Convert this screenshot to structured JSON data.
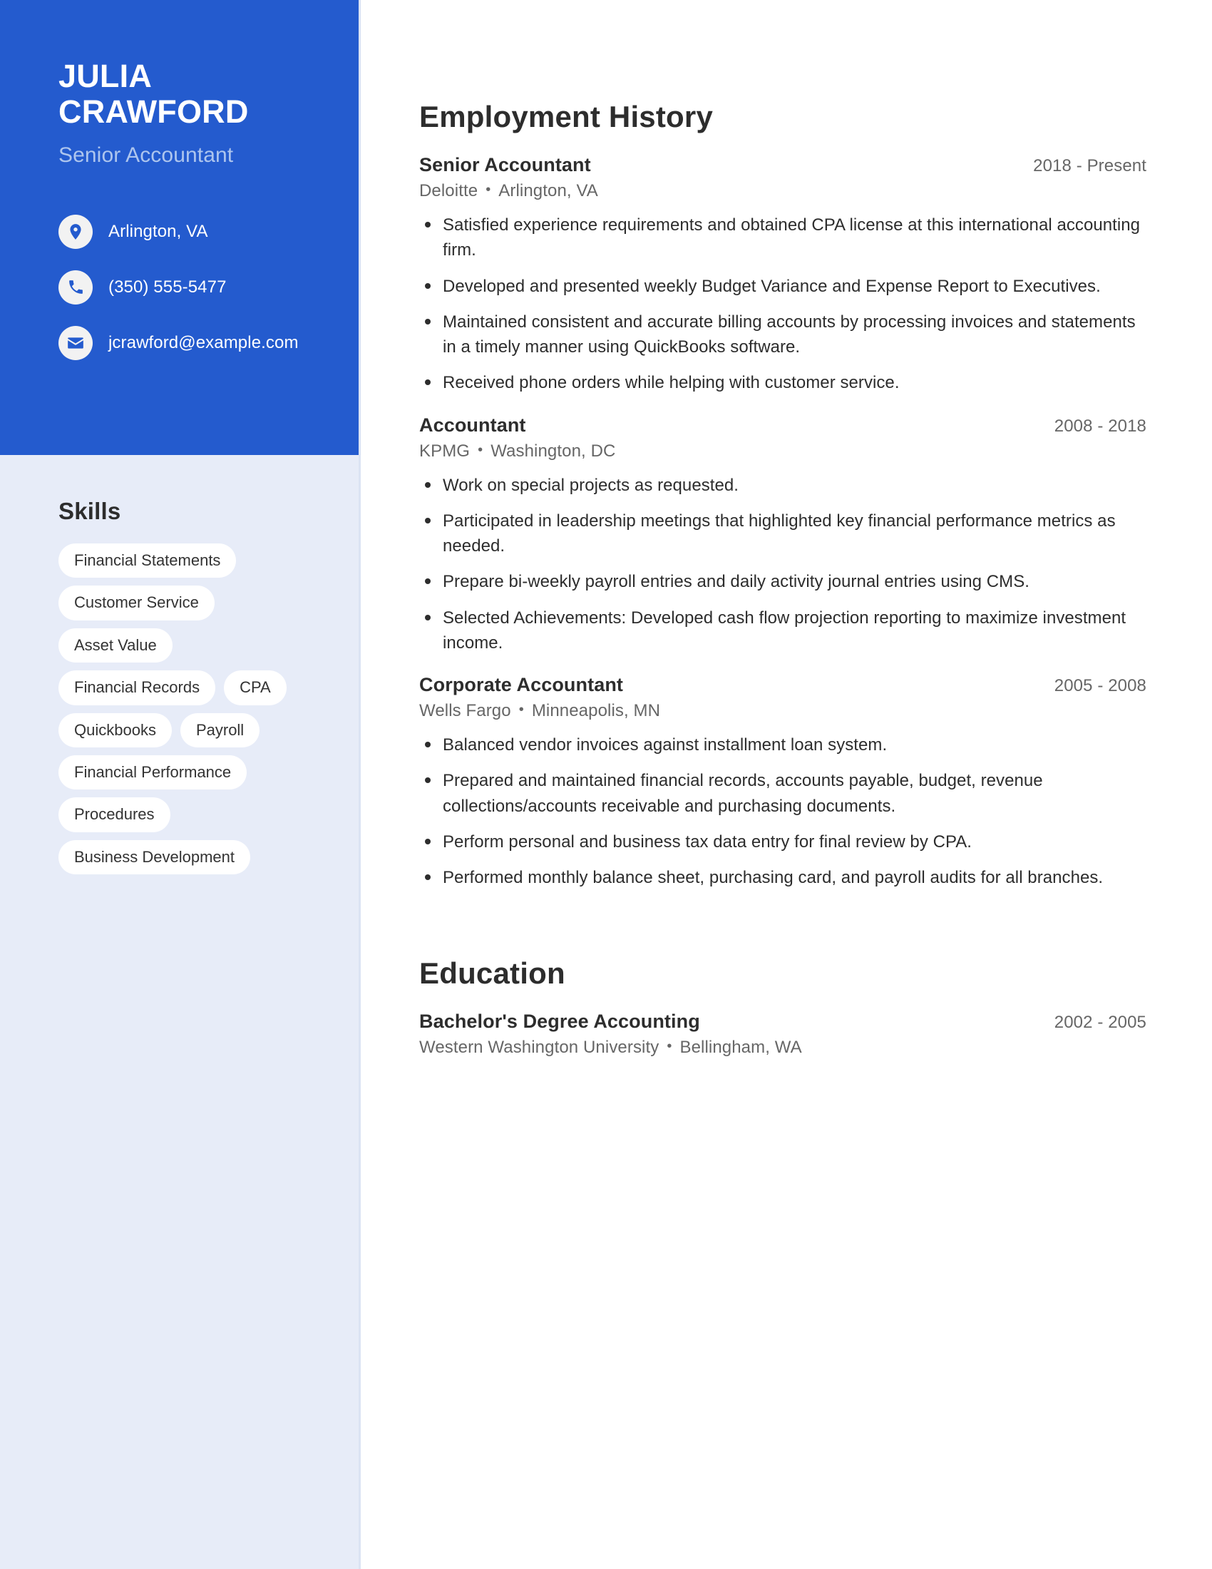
{
  "profile": {
    "first_name": "JULIA",
    "last_name": "CRAWFORD",
    "job_title": "Senior Accountant"
  },
  "contact": {
    "location": "Arlington, VA",
    "phone": "(350) 555-5477",
    "email": "jcrawford@example.com",
    "icons": {
      "location": "location-pin-icon",
      "phone": "phone-icon",
      "email": "envelope-icon"
    }
  },
  "skills": {
    "heading": "Skills",
    "items": [
      "Financial Statements",
      "Customer Service",
      "Asset Value",
      "Financial Records",
      "CPA",
      "Quickbooks",
      "Payroll",
      "Financial Performance",
      "Procedures",
      "Business Development"
    ]
  },
  "employment": {
    "heading": "Employment History",
    "jobs": [
      {
        "title": "Senior Accountant",
        "dates": "2018 - Present",
        "company": "Deloitte",
        "location": "Arlington, VA",
        "bullets": [
          "Satisfied experience requirements and obtained CPA license at this international accounting firm.",
          "Developed and presented weekly Budget Variance and Expense Report to Executives.",
          "Maintained consistent and accurate billing accounts by processing invoices and statements in a timely manner using QuickBooks software.",
          "Received phone orders while helping with customer service."
        ]
      },
      {
        "title": "Accountant",
        "dates": "2008 - 2018",
        "company": "KPMG",
        "location": "Washington, DC",
        "bullets": [
          "Work on special projects as requested.",
          "Participated in leadership meetings that highlighted key financial performance metrics as needed.",
          "Prepare bi-weekly payroll entries and daily activity journal entries using CMS.",
          "Selected Achievements: Developed cash flow projection reporting to maximize investment income."
        ]
      },
      {
        "title": "Corporate Accountant",
        "dates": "2005 - 2008",
        "company": "Wells Fargo",
        "location": "Minneapolis, MN",
        "bullets": [
          "Balanced vendor invoices against installment loan system.",
          "Prepared and maintained financial records, accounts payable, budget, revenue collections/accounts receivable and purchasing documents.",
          "Perform personal and business tax data entry for final review by CPA.",
          "Performed monthly balance sheet, purchasing card, and payroll audits for all branches."
        ]
      }
    ]
  },
  "education": {
    "heading": "Education",
    "entries": [
      {
        "degree": "Bachelor's Degree Accounting",
        "dates": "2002 - 2005",
        "school": "Western Washington University",
        "location": "Bellingham, WA"
      }
    ]
  },
  "colors": {
    "accent_blue": "#245bce",
    "sidebar_bg": "#e7ecf8",
    "title_light_blue": "#adc5ee",
    "text_dark": "#2d2d2d",
    "text_muted": "#666666"
  },
  "separator": "•"
}
